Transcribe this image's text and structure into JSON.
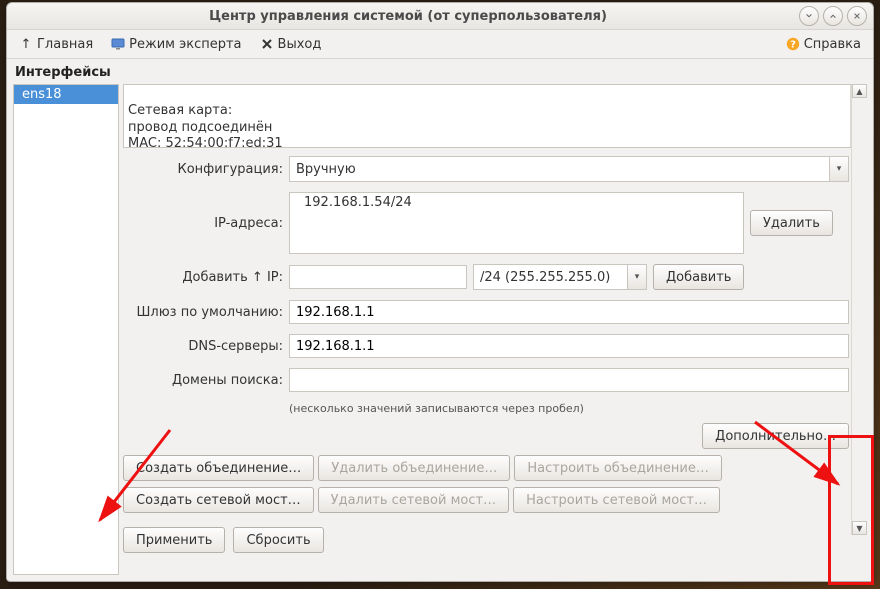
{
  "window": {
    "title": "Центр управления системой (от суперпользователя)"
  },
  "toolbar": {
    "home": "Главная",
    "expert": "Режим эксперта",
    "exit": "Выход",
    "help": "Справка"
  },
  "section": {
    "title": "Интерфейсы"
  },
  "interfaces": [
    {
      "name": "ens18"
    }
  ],
  "info": {
    "text": "Сетевая карта:\nпровод подсоединён\nMAC: 52:54:00:f7:ed:31\nИнтерфейс ВКЛЮЧЕН"
  },
  "labels": {
    "config": "Конфигурация:",
    "ips": "IP-адреса:",
    "add_ip": "Добавить ↑ IP:",
    "gateway": "Шлюз по умолчанию:",
    "dns": "DNS-серверы:",
    "search": "Домены поиска:",
    "hint": "(несколько значений записываются через пробел)"
  },
  "values": {
    "config_mode": "Вручную",
    "ip_list_entry": "192.168.1.54/24",
    "netmask_option": "/24 (255.255.255.0)",
    "gateway": "192.168.1.1",
    "dns": "192.168.1.1",
    "search": "",
    "add_ip": ""
  },
  "buttons": {
    "delete": "Удалить",
    "add": "Добавить",
    "advanced": "Дополнительно…",
    "create_bond": "Создать объединение…",
    "delete_bond": "Удалить объединение…",
    "config_bond": "Настроить объединение…",
    "create_bridge": "Создать сетевой мост…",
    "delete_bridge": "Удалить сетевой мост…",
    "config_bridge": "Настроить сетевой мост…",
    "apply": "Применить",
    "reset": "Сбросить"
  }
}
